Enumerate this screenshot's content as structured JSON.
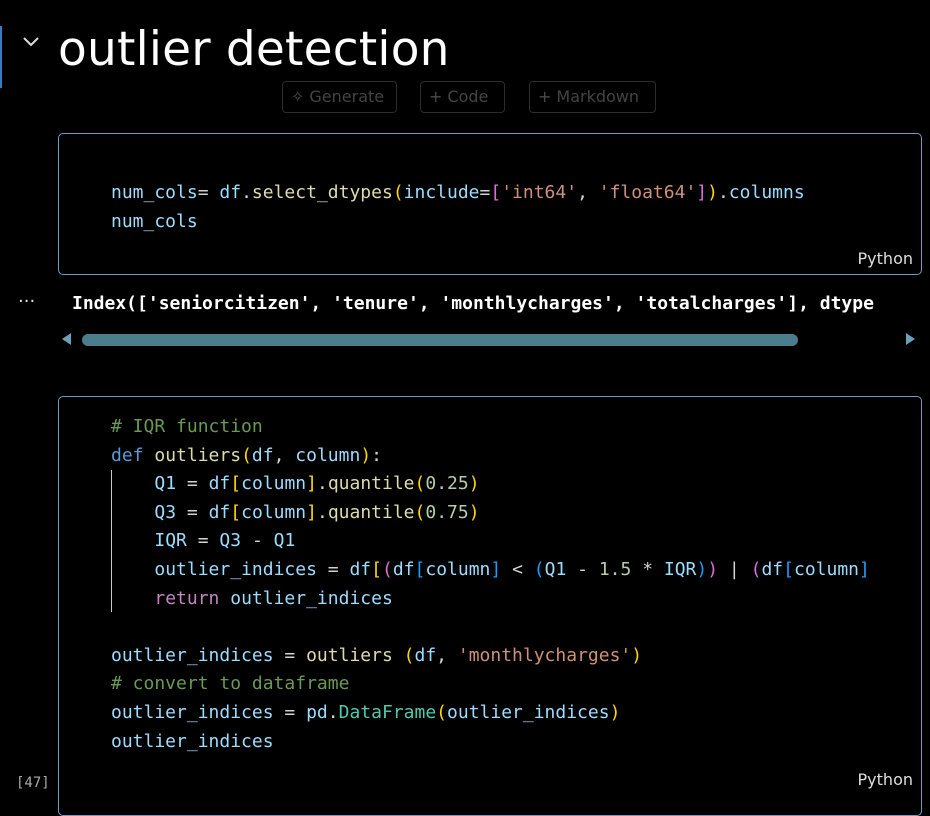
{
  "heading": {
    "title": "outlier detection"
  },
  "toolbar": {
    "generate_label": "Generate",
    "code_label": "Code",
    "markdown_label": "Markdown"
  },
  "cell1": {
    "language": "Python",
    "lines": [
      "num_cols= df.select_dtypes(include=['int64', 'float64']).columns",
      "num_cols"
    ]
  },
  "output1": {
    "ellipsis": "...",
    "text": "Index(['seniorcitizen', 'tenure', 'monthlycharges', 'totalcharges'], dtype"
  },
  "cell2": {
    "language": "Python",
    "execution_count": "[47]",
    "lines": [
      "# IQR function",
      "def outliers(df, column):",
      "    Q1 = df[column].quantile(0.25)",
      "    Q3 = df[column].quantile(0.75)",
      "    IQR = Q3 - Q1",
      "    outlier_indices = df[(df[column] < (Q1 - 1.5 * IQR)) | (df[column]",
      "    return outlier_indices",
      "",
      "outlier_indices = outliers (df, 'monthlycharges')",
      "# convert to dataframe",
      "outlier_indices = pd.DataFrame(outlier_indices)",
      "outlier_indices"
    ]
  },
  "icons": {
    "collapse": "chevron-down-icon",
    "generate": "sparkle-icon",
    "add": "plus-icon"
  },
  "colors": {
    "cell_border": "#6e9bc0",
    "keyword": "#569cd6",
    "variable": "#9cdcfe",
    "string": "#ce9178",
    "function": "#dcdcaa",
    "comment": "#6a9955"
  }
}
